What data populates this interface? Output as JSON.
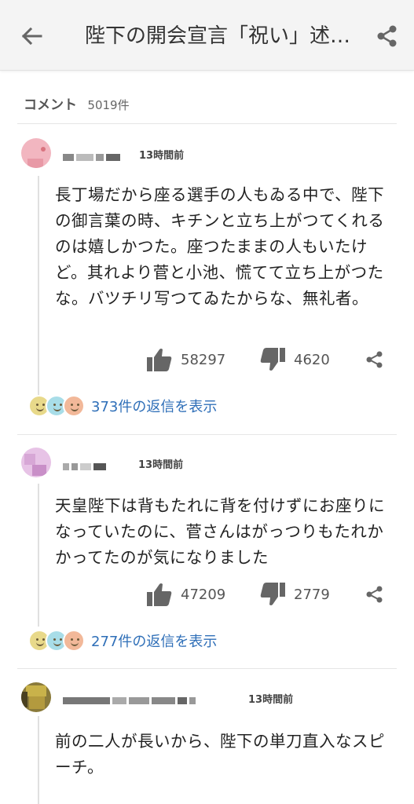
{
  "header": {
    "title": "陛下の開会宣言「祝い」述…"
  },
  "comments_section": {
    "label": "コメント",
    "count": "5019件"
  },
  "comments": [
    {
      "time": "13時間前",
      "text": "長丁場だから座る選手の人もゐる中で、陛下の御言葉の時、キチンと立ち上がつてくれるのは嬉しかつた。座つたままの人もいたけど。其れより菅と小池、慌てて立ち上がつたな。バツチリ写つてゐたからな、無礼者。",
      "likes": "58297",
      "dislikes": "4620",
      "replies": "373件の返信を表示"
    },
    {
      "time": "13時間前",
      "text": "天皇陛下は背もたれに背を付けずにお座りになっていたのに、菅さんはがっつりもたれかかってたのが気になりました",
      "likes": "47209",
      "dislikes": "2779",
      "replies": "277件の返信を表示"
    },
    {
      "time": "13時間前",
      "text": "前の二人が長いから、陛下の単刀直入なスピーチ。"
    }
  ],
  "colors": {
    "link": "#2f6fb8",
    "appbar": "#f4f4f4"
  }
}
